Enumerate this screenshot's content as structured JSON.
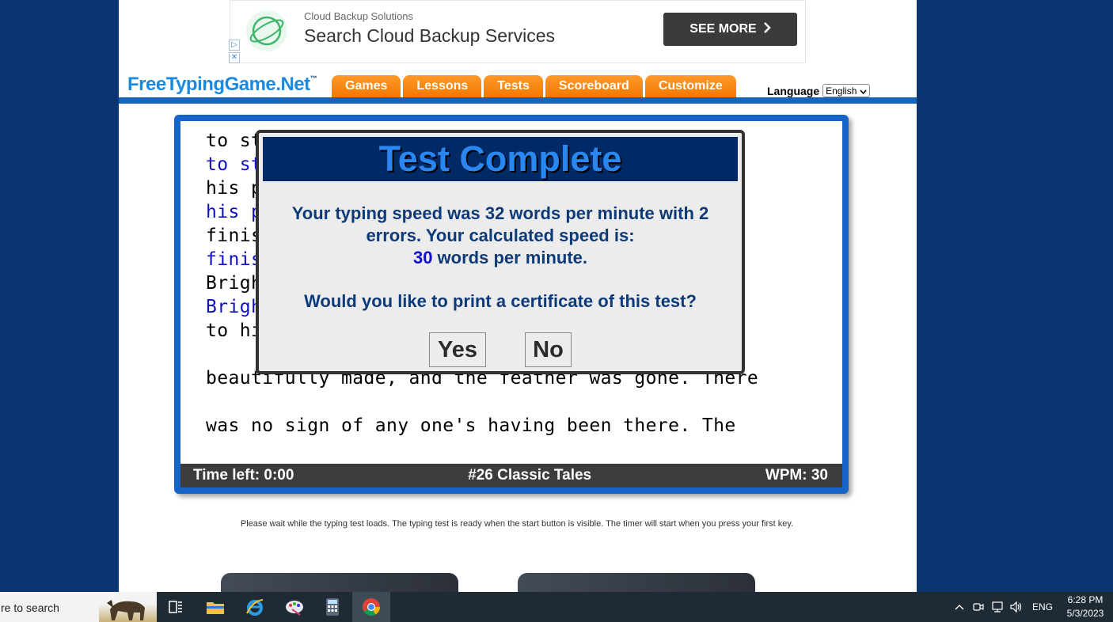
{
  "ad": {
    "brand": "Cloud Backup Solutions",
    "headline": "Search Cloud Backup Services",
    "cta_label": "SEE MORE",
    "cta_icon": "chevron-right-icon",
    "choice_icons": [
      "adchoices-play-icon",
      "adchoices-close-icon"
    ]
  },
  "header": {
    "logo": "FreeTypingGame.Net",
    "logo_tm": "™",
    "nav": [
      "Games",
      "Lessons",
      "Tests",
      "Scoreboard",
      "Customize"
    ],
    "language_label": "Language",
    "language_selected": "English"
  },
  "game": {
    "lines": [
      {
        "text": "to st                                   said",
        "kind": "typed"
      },
      {
        "text": "to st                                   said",
        "kind": "source"
      },
      {
        "text": "his p                                   ould",
        "kind": "typed"
      },
      {
        "text": "his p                                   ould",
        "kind": "source"
      },
      {
        "text": "finis",
        "kind": "typed"
      },
      {
        "text": "finis",
        "kind": "source"
      },
      {
        "text": "Brigh                                   went",
        "kind": "typed"
      },
      {
        "text": "Brigh",
        "kind": "source"
      },
      {
        "text": "to hi",
        "kind": "typed"
      },
      {
        "text": "",
        "kind": "typed"
      },
      {
        "text": "beautifully made, and the feather was gone. There",
        "kind": "typed"
      },
      {
        "text": "",
        "kind": "typed"
      },
      {
        "text": "was no sign of any one's having been there. The",
        "kind": "typed"
      }
    ],
    "status": {
      "time_left": "Time left: 0:00",
      "test_name": "#26 Classic Tales",
      "wpm": "WPM: 30"
    }
  },
  "modal": {
    "title": "Test Complete",
    "line1": "Your typing speed was 32 words per minute with 2",
    "line2": "errors. Your calculated speed is:",
    "speed_value": "30",
    "speed_suffix": " words per minute.",
    "question": "Would you like to print a certificate of this test?",
    "yes_label": "Yes",
    "no_label": "No"
  },
  "notice": "Please wait while the typing test loads. The typing test is ready when the start button is visible. The timer will start when you press your first key.",
  "taskbar": {
    "search_placeholder": "re to search",
    "apps": [
      "task-view-icon",
      "file-explorer-icon",
      "internet-explorer-icon",
      "paint-icon",
      "calculator-icon",
      "chrome-icon"
    ],
    "tray_language": "ENG",
    "time": "6:28 PM",
    "date": "5/3/2023"
  },
  "colors": {
    "page_bg": "#0a3570",
    "nav_orange": "#f37800",
    "panel_blue": "#1565c8",
    "modal_title_bg": "#002a66",
    "modal_text": "#0d3a78"
  }
}
